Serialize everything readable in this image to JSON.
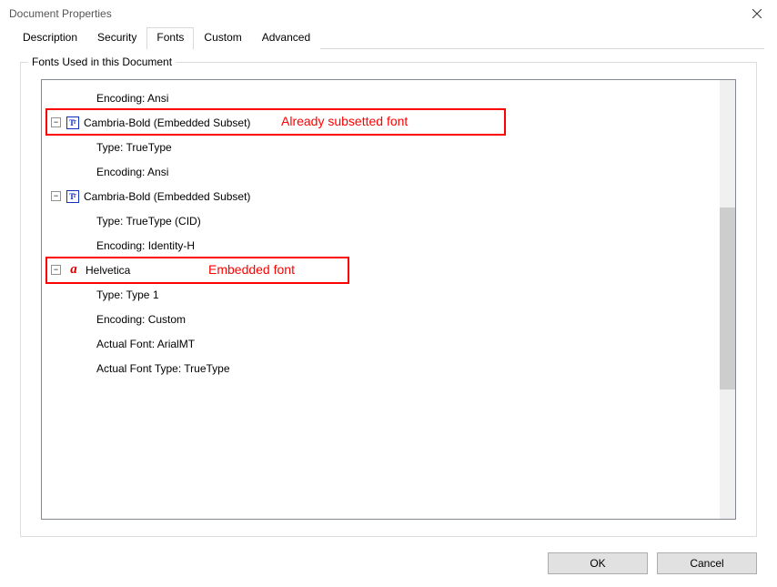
{
  "window": {
    "title": "Document Properties"
  },
  "tabs": {
    "description": "Description",
    "security": "Security",
    "fonts": "Fonts",
    "custom": "Custom",
    "advanced": "Advanced"
  },
  "group": {
    "legend": "Fonts Used in this Document"
  },
  "tree": {
    "item0_detail_encoding": "Encoding: Ansi",
    "item1_name": "Cambria-Bold (Embedded Subset)",
    "item1_detail_type": "Type: TrueType",
    "item1_detail_encoding": "Encoding: Ansi",
    "item2_name": "Cambria-Bold (Embedded Subset)",
    "item2_detail_type": "Type: TrueType (CID)",
    "item2_detail_encoding": "Encoding: Identity-H",
    "item3_name": "Helvetica",
    "item3_detail_type": "Type: Type 1",
    "item3_detail_encoding": "Encoding: Custom",
    "item3_detail_actual_font": "Actual Font: ArialMT",
    "item3_detail_actual_font_type": "Actual Font Type: TrueType"
  },
  "icons": {
    "tt_glyph": "T",
    "a_glyph": "a",
    "minus": "−"
  },
  "annotations": {
    "subsetted": "Already subsetted font",
    "embedded": "Embedded font"
  },
  "buttons": {
    "ok": "OK",
    "cancel": "Cancel"
  }
}
